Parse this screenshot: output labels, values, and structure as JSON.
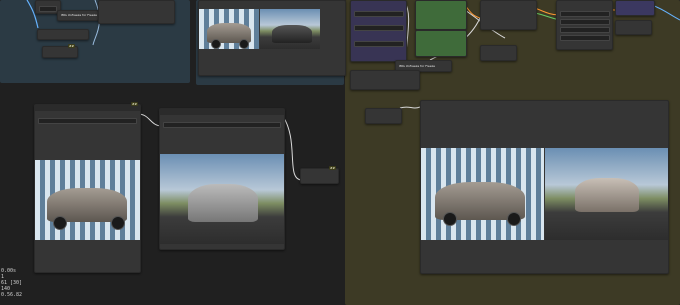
{
  "colors": {
    "canvas": "#202020",
    "group_teal": "#2b3a44",
    "group_olive": "#3d3a25",
    "wire_white": "#d9d9d9",
    "wire_blue": "#66b3ff",
    "wire_orange": "#ff9933",
    "wire_green": "#66cc66",
    "node_body": "#353535"
  },
  "labels": {
    "node_a": "IMG Unfreeze for Freeze",
    "node_b": "IMG Unfreeze for Freeze",
    "badge": "##"
  },
  "status": {
    "line1": "0.00s",
    "line2": "1",
    "line3": "61 [30]",
    "line4": "140",
    "line5": "0.56.82"
  },
  "icons": [
    "status-text",
    "thumbnail-image"
  ]
}
